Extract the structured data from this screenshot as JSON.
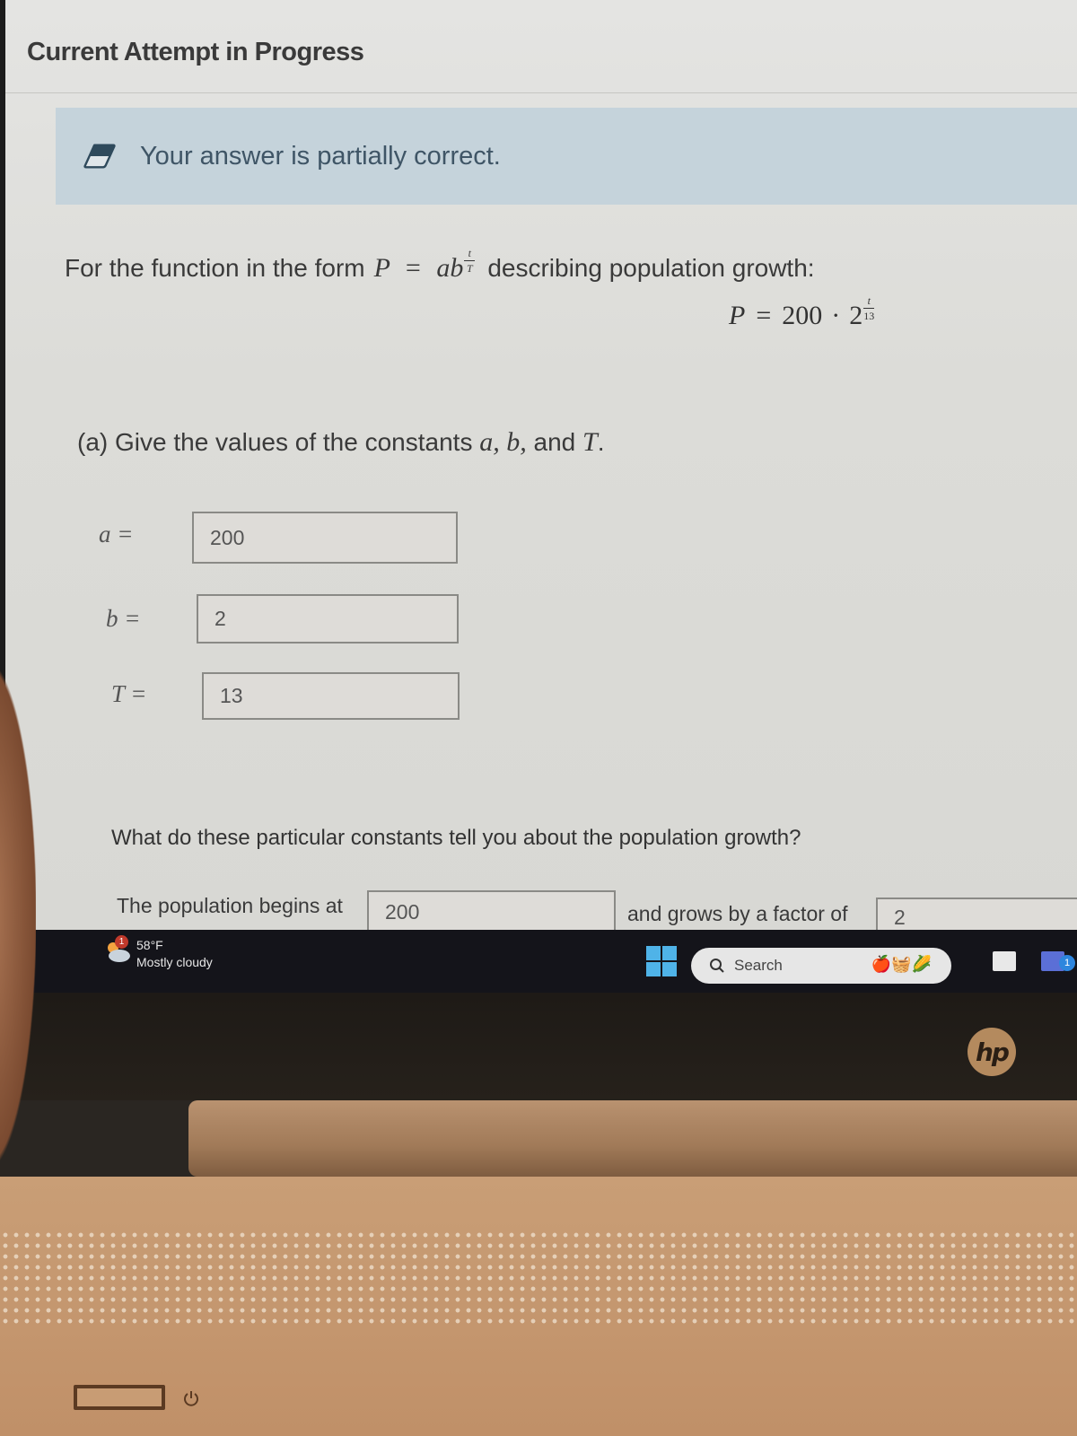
{
  "header": {
    "title": "Current Attempt in Progress"
  },
  "feedback": {
    "icon": "eraser-icon",
    "message": "Your answer is partially correct."
  },
  "problem": {
    "intro_before": "For the function in the form",
    "general_form": {
      "lhs": "P",
      "equals": "=",
      "base": "ab",
      "exp_num": "t",
      "exp_den": "T"
    },
    "intro_after": "describing population growth:",
    "specific_form": {
      "lhs": "P",
      "equals": "=",
      "a": "200",
      "dot": "·",
      "b": "2",
      "exp_num": "t",
      "exp_den": "13"
    }
  },
  "part_a": {
    "prompt_prefix": "(a) Give the values of the constants",
    "prompt_vars": "a, b,",
    "prompt_and": "and",
    "prompt_T": "T",
    "prompt_end": ".",
    "fields": [
      {
        "label": "a =",
        "value": "200"
      },
      {
        "label": "b =",
        "value": "2"
      },
      {
        "label": "T =",
        "value": "13"
      }
    ]
  },
  "interpretation": {
    "question": "What do these particular constants tell you about the population growth?",
    "begins_label": "The population begins at",
    "begins_value": "200",
    "grows_label": "and grows by a factor of",
    "grows_value": "2"
  },
  "taskbar": {
    "weather_badge": "1",
    "weather_temp": "58°F",
    "weather_desc": "Mostly cloudy",
    "search_label": "Search",
    "notification_count": "1"
  },
  "laptop": {
    "brand": "hp"
  }
}
